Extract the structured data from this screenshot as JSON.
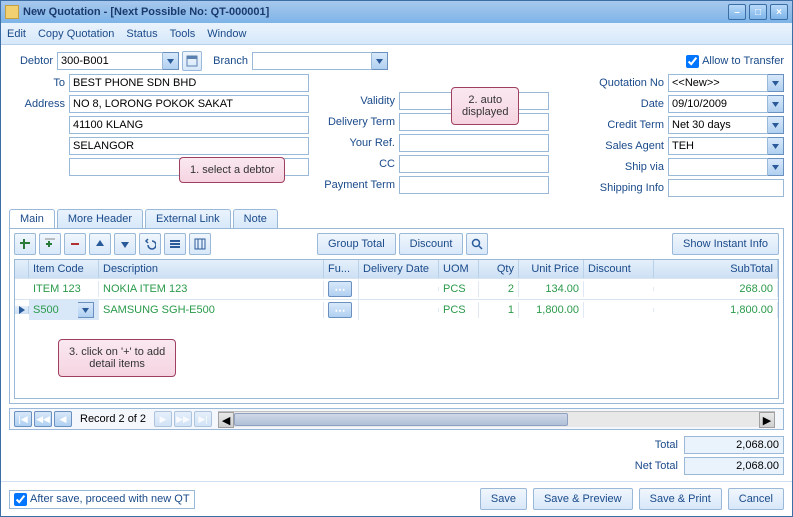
{
  "window": {
    "title": "New Quotation - [Next Possible No: QT-000001]"
  },
  "menu": {
    "edit": "Edit",
    "copy": "Copy Quotation",
    "status": "Status",
    "tools": "Tools",
    "window": "Window"
  },
  "header": {
    "debtor_label": "Debtor",
    "debtor": "300-B001",
    "branch_label": "Branch",
    "branch": "",
    "to_label": "To",
    "to": "BEST PHONE SDN BHD",
    "address_label": "Address",
    "addr1": "NO 8, LORONG POKOK SAKAT",
    "addr2": "41100 KLANG",
    "addr3": "SELANGOR",
    "addr4": "",
    "allow_transfer": "Allow to Transfer",
    "validity_label": "Validity",
    "validity": "",
    "deliveryterm_label": "Delivery Term",
    "deliveryterm": "",
    "yourref_label": "Your Ref.",
    "yourref": "",
    "cc_label": "CC",
    "cc": "",
    "paymentterm_label": "Payment Term",
    "paymentterm": "",
    "quotno_label": "Quotation No",
    "quotno": "<<New>>",
    "date_label": "Date",
    "date": "09/10/2009",
    "creditterm_label": "Credit Term",
    "creditterm": "Net 30 days",
    "salesagent_label": "Sales Agent",
    "salesagent": "TEH",
    "shipvia_label": "Ship via",
    "shipvia": "",
    "shippinginfo_label": "Shipping Info",
    "shippinginfo": ""
  },
  "callouts": {
    "c1": "1. select a debtor",
    "c2": "2. auto\ndisplayed",
    "c3": "3. click on '+' to add\ndetail items"
  },
  "tabs": {
    "main": "Main",
    "more": "More Header",
    "external": "External Link",
    "note": "Note"
  },
  "toolbar": {
    "grouptotal": "Group Total",
    "discount": "Discount",
    "showinstant": "Show Instant Info"
  },
  "grid": {
    "cols": {
      "itemcode": "Item Code",
      "description": "Description",
      "fu": "Fu...",
      "delivery": "Delivery Date",
      "uom": "UOM",
      "qty": "Qty",
      "unitprice": "Unit Price",
      "discount": "Discount",
      "subtotal": "SubTotal"
    },
    "rows": [
      {
        "itemcode": "ITEM 123",
        "description": "NOKIA ITEM 123",
        "uom": "PCS",
        "qty": "2",
        "unitprice": "134.00",
        "discount": "",
        "subtotal": "268.00"
      },
      {
        "itemcode": "S500",
        "description": "SAMSUNG SGH-E500",
        "uom": "PCS",
        "qty": "1",
        "unitprice": "1,800.00",
        "discount": "",
        "subtotal": "1,800.00"
      }
    ]
  },
  "nav": {
    "record": "Record 2 of 2"
  },
  "totals": {
    "total_label": "Total",
    "total": "2,068.00",
    "nettotal_label": "Net Total",
    "nettotal": "2,068.00"
  },
  "footer": {
    "aftersave": "After save, proceed with new QT",
    "save": "Save",
    "savepreview": "Save & Preview",
    "saveprint": "Save & Print",
    "cancel": "Cancel"
  }
}
